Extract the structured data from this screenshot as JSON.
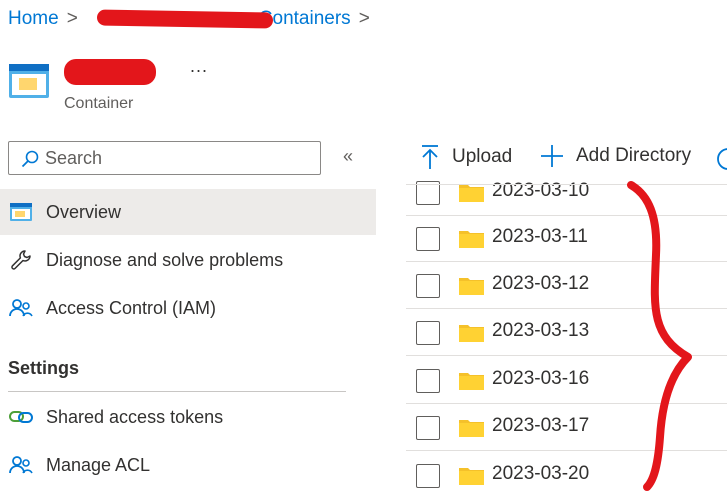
{
  "breadcrumb": {
    "home": "Home",
    "storage_account": "",
    "containers": "Containers",
    "separator": ">"
  },
  "resource": {
    "name": "",
    "type": "Container",
    "more": "..."
  },
  "sidebar": {
    "search_placeholder": "Search",
    "collapse": "«",
    "items": [
      {
        "label": "Overview",
        "icon": "container-icon",
        "active": true
      },
      {
        "label": "Diagnose and solve problems",
        "icon": "wrench-icon"
      },
      {
        "label": "Access Control (IAM)",
        "icon": "people-icon"
      }
    ],
    "settings_heading": "Settings",
    "settings_items": [
      {
        "label": "Shared access tokens",
        "icon": "link-icon"
      },
      {
        "label": "Manage ACL",
        "icon": "people-icon"
      }
    ]
  },
  "toolbar": {
    "upload": "Upload",
    "add_directory": "Add Directory",
    "refresh_icon": "refresh-icon"
  },
  "files": [
    {
      "name": "2023-03-10",
      "icon": "folder-icon"
    },
    {
      "name": "2023-03-11",
      "icon": "folder-icon"
    },
    {
      "name": "2023-03-12",
      "icon": "folder-icon"
    },
    {
      "name": "2023-03-13",
      "icon": "folder-icon"
    },
    {
      "name": "2023-03-16",
      "icon": "folder-icon"
    },
    {
      "name": "2023-03-17",
      "icon": "folder-icon"
    },
    {
      "name": "2023-03-20",
      "icon": "folder-icon"
    }
  ],
  "colors": {
    "link": "#0078d4",
    "folder": "#ffb900",
    "annotation": "#e3161b",
    "active_nav": "#edebe9"
  }
}
